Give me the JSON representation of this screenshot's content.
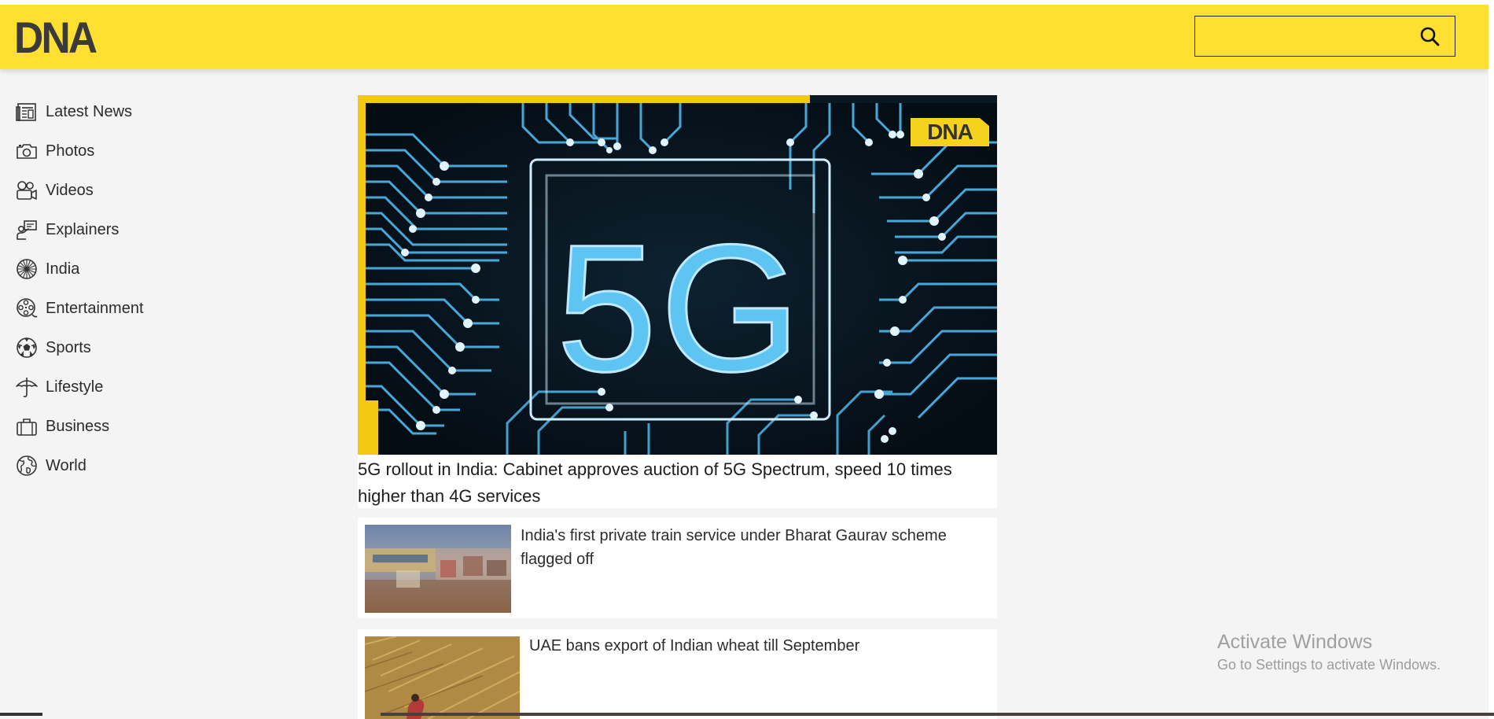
{
  "header": {
    "logo": "DNA",
    "search": {
      "value": "",
      "placeholder": ""
    },
    "brand_color": "#ffdf2f"
  },
  "sidebar": {
    "items": [
      {
        "label": "Latest News",
        "icon": "newspaper-icon"
      },
      {
        "label": "Photos",
        "icon": "camera-icon"
      },
      {
        "label": "Videos",
        "icon": "video-camera-icon"
      },
      {
        "label": "Explainers",
        "icon": "presenter-icon"
      },
      {
        "label": "India",
        "icon": "ashoka-chakra-icon"
      },
      {
        "label": "Entertainment",
        "icon": "film-reel-icon"
      },
      {
        "label": "Sports",
        "icon": "soccer-ball-icon"
      },
      {
        "label": "Lifestyle",
        "icon": "umbrella-icon"
      },
      {
        "label": "Business",
        "icon": "briefcase-icon"
      },
      {
        "label": "World",
        "icon": "globe-icon"
      }
    ]
  },
  "main": {
    "hero": {
      "image_text": "5G",
      "badge": "DNA",
      "title": "5G rollout in India: Cabinet approves auction of 5G Spectrum, speed 10 times higher than 4G services"
    },
    "stories": [
      {
        "title": "India's first private train service under Bharat Gaurav scheme flagged off"
      },
      {
        "title": "UAE bans export of Indian wheat till September"
      }
    ]
  },
  "watermark": {
    "title": "Activate Windows",
    "subtitle": "Go to Settings to activate Windows."
  }
}
